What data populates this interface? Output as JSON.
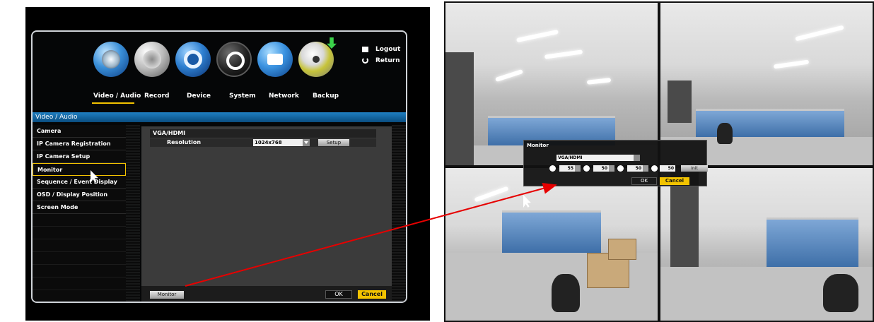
{
  "menu": {
    "tabs": [
      {
        "label": "Video / Audio",
        "icon": "video-audio-icon",
        "active": true
      },
      {
        "label": "Record",
        "icon": "record-icon"
      },
      {
        "label": "Device",
        "icon": "device-icon"
      },
      {
        "label": "System",
        "icon": "system-icon"
      },
      {
        "label": "Network",
        "icon": "network-icon"
      },
      {
        "label": "Backup",
        "icon": "backup-icon"
      }
    ],
    "logout_label": "Logout",
    "return_label": "Return",
    "section_title": "Video / Audio",
    "side_items": [
      {
        "label": "Camera"
      },
      {
        "label": "IP Camera Registration"
      },
      {
        "label": "IP Camera Setup"
      },
      {
        "label": "Monitor",
        "active": true
      },
      {
        "label": "Sequence / Event Display"
      },
      {
        "label": "OSD / Display Position"
      },
      {
        "label": "Screen Mode"
      }
    ],
    "vga_hdmi_label": "VGA/HDMI",
    "resolution_label": "Resolution",
    "resolution_value": "1024x768",
    "setup_label": "Setup",
    "monitor_button": "Monitor",
    "ok_label": "OK",
    "cancel_label": "Cancel"
  },
  "monitor_dialog": {
    "title": "Monitor",
    "output_value": "VGA/HDMI",
    "brightness": "55",
    "contrast": "50",
    "saturation": "50",
    "hue": "50",
    "init_label": "Init",
    "ok_label": "OK",
    "cancel_label": "Cancel"
  },
  "colors": {
    "accent_yellow": "#f2c300",
    "section_blue": "#1f7fc2",
    "arrow_red": "#e60000"
  }
}
